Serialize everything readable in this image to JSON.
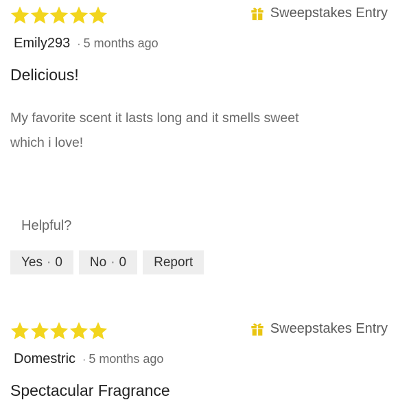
{
  "colors": {
    "star": "#f2d51e",
    "gift": "#e9c512",
    "muted_text": "#6a6a6a",
    "button_bg": "#eeeeee"
  },
  "reviews": [
    {
      "rating": 5,
      "sweepstakes_label": "Sweepstakes Entry",
      "author": "Emily293",
      "time_ago": "5 months ago",
      "title": "Delicious!",
      "body_lines": [
        "My favorite scent it lasts long and it smells sweet",
        "which i love!"
      ],
      "helpful_label": "Helpful?",
      "yes_label": "Yes",
      "yes_count": "0",
      "no_label": "No",
      "no_count": "0",
      "report_label": "Report"
    },
    {
      "rating": 5,
      "sweepstakes_label": "Sweepstakes Entry",
      "author": "Domestric",
      "time_ago": "5 months ago",
      "title": "Spectacular Fragrance"
    }
  ]
}
